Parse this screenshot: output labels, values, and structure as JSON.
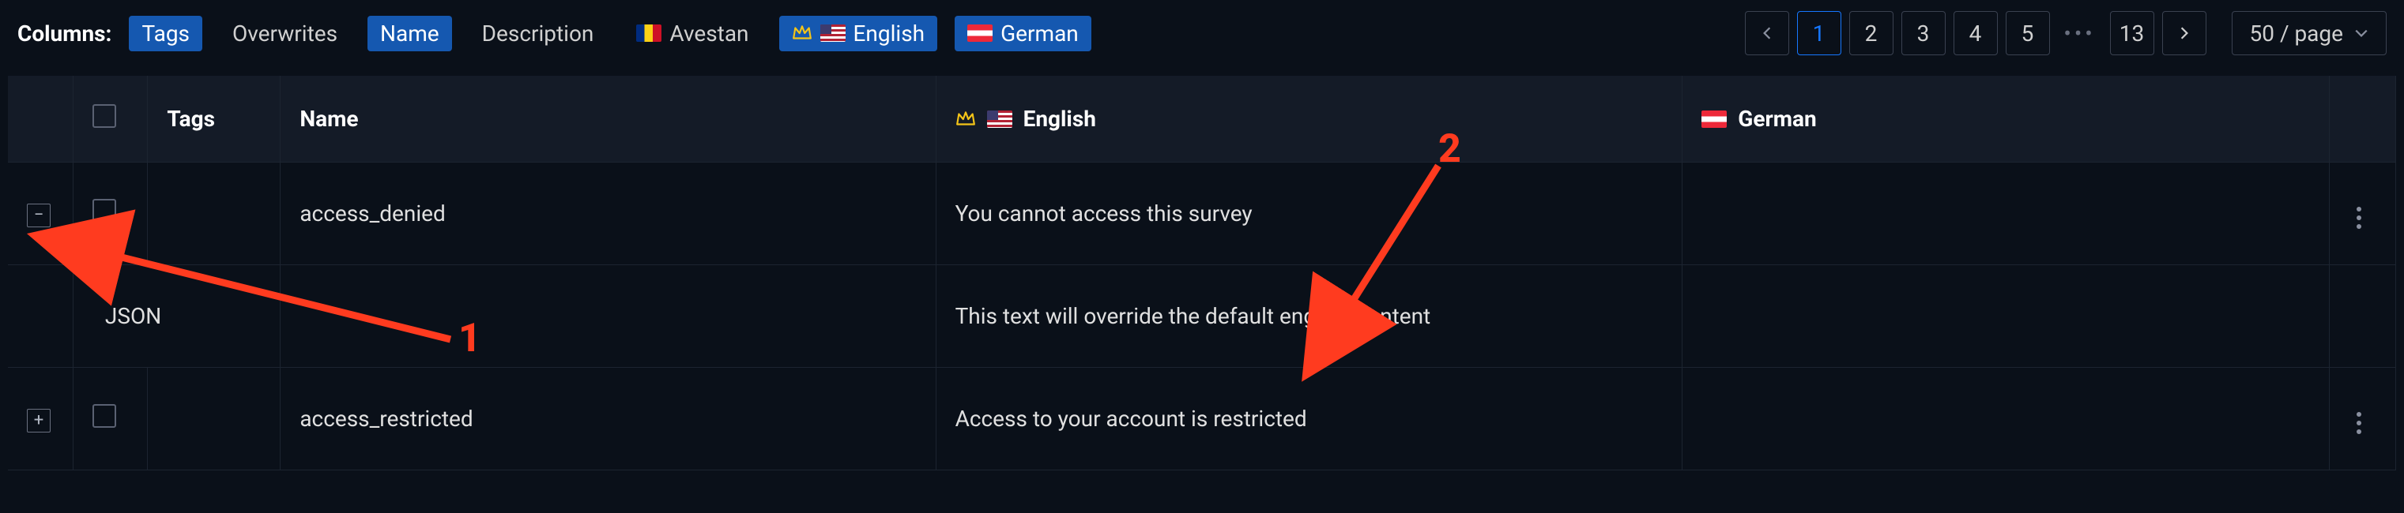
{
  "topbar": {
    "columns_label": "Columns:",
    "chips": {
      "tags": "Tags",
      "overwrites": "Overwrites",
      "name": "Name",
      "description": "Description",
      "avestan": "Avestan",
      "english": "English",
      "german": "German"
    }
  },
  "pagination": {
    "pages": [
      "1",
      "2",
      "3",
      "4",
      "5"
    ],
    "last": "13",
    "ellipsis": "•••",
    "page_size": "50 / page"
  },
  "table": {
    "headers": {
      "tags": "Tags",
      "name": "Name",
      "english": "English",
      "german": "German"
    },
    "rows": [
      {
        "expander": "−",
        "tags": "",
        "name": "access_denied",
        "english": "You cannot access this survey",
        "german": ""
      },
      {
        "expander": "",
        "tags": "JSON",
        "name": "",
        "english": "This text will override the default english content",
        "german": ""
      },
      {
        "expander": "+",
        "tags": "",
        "name": "access_restricted",
        "english": "Access to your account is restricted",
        "german": ""
      }
    ]
  },
  "annotations": {
    "a1": "1",
    "a2": "2"
  }
}
